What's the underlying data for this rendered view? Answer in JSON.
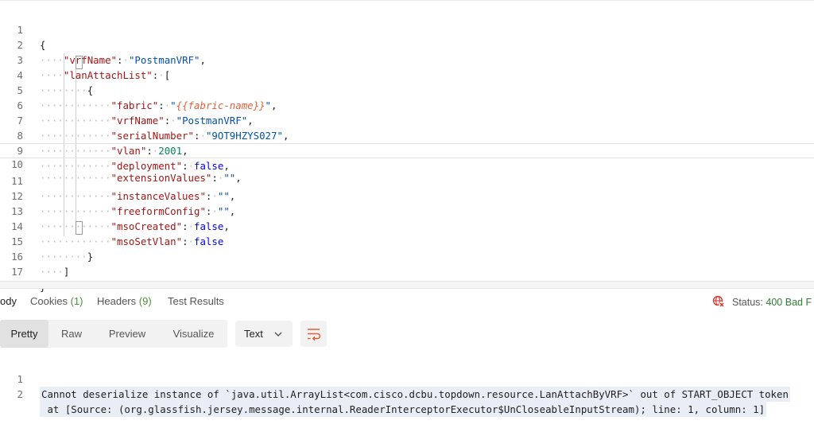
{
  "editor": {
    "line_numbers": [
      "1",
      "2",
      "3",
      "4",
      "5",
      "6",
      "7",
      "8",
      "9",
      "10",
      "11",
      "12",
      "13",
      "14",
      "15",
      "16",
      "17"
    ],
    "punct": {
      "open_brace": "{",
      "close_brace": "}",
      "open_bracket": "[",
      "close_bracket": "]",
      "colon": ":",
      "comma": ",",
      "quote": "\""
    },
    "keys": {
      "vrfName": "vrfName",
      "lanAttachList": "lanAttachList",
      "fabric": "fabric",
      "serialNumber": "serialNumber",
      "vlan": "vlan",
      "deployment": "deployment",
      "extensionValues": "extensionValues",
      "instanceValues": "instanceValues",
      "freeformConfig": "freeformConfig",
      "msoCreated": "msoCreated",
      "msoSetVlan": "msoSetVlan"
    },
    "values": {
      "vrfName": "PostmanVRF",
      "fabric_var": "{{fabric-name}}",
      "serialNumber": "9OT9HZYS027",
      "vlan": "2001",
      "false": "false",
      "empty": ""
    }
  },
  "response": {
    "tabs": [
      {
        "label": "ody"
      },
      {
        "label": "Cookies",
        "count": "(1)"
      },
      {
        "label": "Headers",
        "count": "(9)"
      },
      {
        "label": "Test Results"
      }
    ],
    "status_label": "Status:",
    "status_code": "400 Bad F",
    "status_icon": "globe-error-icon",
    "view_modes": [
      "Pretty",
      "Raw",
      "Preview",
      "Visualize"
    ],
    "format": "Text",
    "wrap_icon": "wrap-lines-icon",
    "body_line_numbers": [
      "1",
      "2"
    ],
    "body_lines": [
      "Cannot deserialize instance of `java.util.ArrayList<com.cisco.dcbu.topdown.resource.LanAttachByVRF>` out of START_OBJECT token",
      " at [Source: (org.glassfish.jersey.message.internal.ReaderInterceptorExecutor$UnCloseableInputStream); line: 1, column: 1]"
    ]
  },
  "colors": {
    "key": "#a31515",
    "string": "#0451a5",
    "number": "#098658",
    "boolean": "#0000ff",
    "variable": "#e0603a",
    "status_ok": "#2f7d32",
    "status_icon": "#d9322d"
  }
}
